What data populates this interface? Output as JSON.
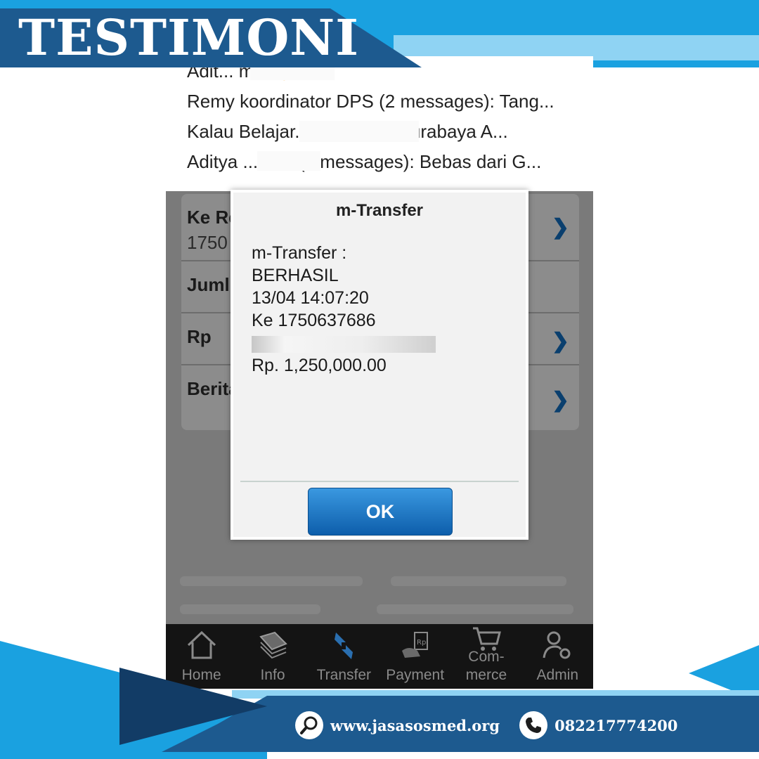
{
  "banner": {
    "title": "TESTIMONI"
  },
  "notifications": [
    {
      "text": "Adit... mak😊"
    },
    {
      "text": "Remy koordinator DPS (2 messages):  Tang..."
    },
    {
      "text": "Kalau Belajar... Nancy W. Surabaya A..."
    },
    {
      "text": "Aditya ... Bali (2 messages):  Bebas dari G..."
    }
  ],
  "form": {
    "rows": [
      {
        "label": "Ke Re",
        "sub": "1750"
      },
      {
        "label": "Juml",
        "sub": ""
      },
      {
        "label": "Rp",
        "sub": ""
      },
      {
        "label": "Berita",
        "sub": ""
      }
    ]
  },
  "dialog": {
    "title": "m-Transfer",
    "line1": "m-Transfer :",
    "status": "BERHASIL",
    "datetime": "13/04 14:07:20",
    "destination": "Ke 1750637686",
    "amount": "Rp. 1,250,000.00",
    "ok_label": "OK"
  },
  "nav": {
    "items": [
      {
        "label": "Home",
        "icon": "home-icon"
      },
      {
        "label": "Info",
        "icon": "book-icon"
      },
      {
        "label": "Transfer",
        "icon": "transfer-icon"
      },
      {
        "label": "Payment",
        "icon": "payment-icon"
      },
      {
        "label": "Com-\nmerce",
        "icon": "cart-icon"
      },
      {
        "label": "Admin",
        "icon": "admin-gear-icon"
      }
    ]
  },
  "footer": {
    "website": "www.jasasosmed.org",
    "phone": "082217774200"
  },
  "colors": {
    "banner_blue": "#1aa1e0",
    "banner_dark": "#1d5a8f",
    "ok_button": "#1a6fc0"
  }
}
